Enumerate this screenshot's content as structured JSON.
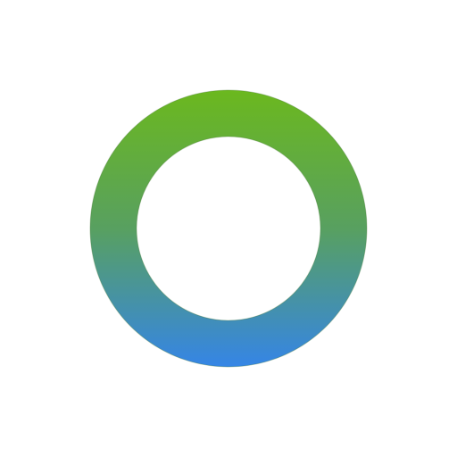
{
  "icon": {
    "name": "ring-icon",
    "colors": {
      "background": "#ffffff",
      "gradient_top": "#6bb81e",
      "gradient_middle": "#58a060",
      "gradient_bottom": "#3585e6",
      "outline": "#4a7a3a"
    }
  }
}
